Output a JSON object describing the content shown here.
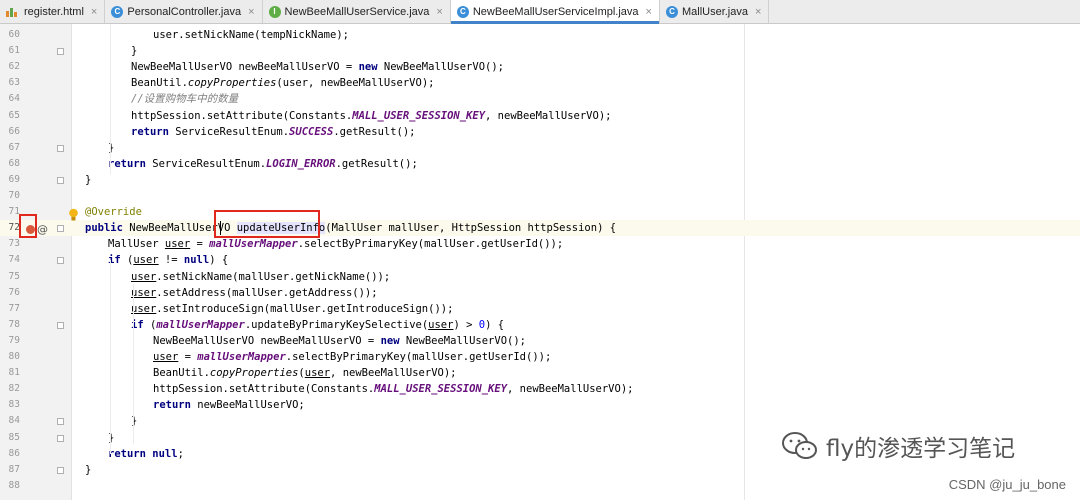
{
  "tabs": [
    {
      "label": "register.html",
      "icon": "html-file-icon",
      "active": false
    },
    {
      "label": "PersonalController.java",
      "icon": "class-file-icon",
      "active": false
    },
    {
      "label": "NewBeeMallUserService.java",
      "icon": "interface-file-icon",
      "active": false
    },
    {
      "label": "NewBeeMallUserServiceImpl.java",
      "icon": "class-file-icon",
      "active": true
    },
    {
      "label": "MallUser.java",
      "icon": "class-file-icon",
      "active": false
    }
  ],
  "close_glyph": "×",
  "code_lines": [
    {
      "n": "60",
      "segs": [
        [
          "user.setNickName(tempNickName);",
          ""
        ]
      ]
    },
    {
      "n": "61",
      "segs": [
        [
          "}",
          ""
        ]
      ]
    },
    {
      "n": "62",
      "segs": [
        [
          "NewBeeMallUserVO newBeeMallUserVO = ",
          ""
        ],
        [
          "new",
          "kw"
        ],
        [
          " NewBeeMallUserVO();",
          ""
        ]
      ]
    },
    {
      "n": "63",
      "segs": [
        [
          "BeanUtil.",
          ""
        ],
        [
          "copyProperties",
          "stat"
        ],
        [
          "(user, newBeeMallUserVO);",
          ""
        ]
      ]
    },
    {
      "n": "64",
      "segs": [
        [
          "//设置购物车中的数量",
          "cmt"
        ]
      ]
    },
    {
      "n": "65",
      "segs": [
        [
          "httpSession.setAttribute(Constants.",
          ""
        ],
        [
          "MALL_USER_SESSION_KEY",
          "fld"
        ],
        [
          ", newBeeMallUserVO);",
          ""
        ]
      ]
    },
    {
      "n": "66",
      "segs": [
        [
          "return",
          "kw"
        ],
        [
          " ServiceResultEnum.",
          ""
        ],
        [
          "SUCCESS",
          "fld"
        ],
        [
          ".getResult();",
          ""
        ]
      ]
    },
    {
      "n": "67",
      "segs": [
        [
          "}",
          ""
        ]
      ]
    },
    {
      "n": "68",
      "segs": [
        [
          "return",
          "kw"
        ],
        [
          " ServiceResultEnum.",
          ""
        ],
        [
          "LOGIN_ERROR",
          "fld"
        ],
        [
          ".getResult();",
          ""
        ]
      ]
    },
    {
      "n": "69",
      "segs": [
        [
          "}",
          ""
        ]
      ]
    },
    {
      "n": "70",
      "segs": []
    },
    {
      "n": "71",
      "segs": [
        [
          "@Override",
          "ann"
        ]
      ]
    },
    {
      "n": "72",
      "segs": [
        [
          "public",
          "kw"
        ],
        [
          " NewBeeMallUserVO ",
          ""
        ],
        [
          "updateUserInfo",
          ""
        ],
        [
          "(MallUser mallUser, HttpSession httpSession) {",
          ""
        ]
      ]
    },
    {
      "n": "73",
      "segs": [
        [
          "MallUser ",
          ""
        ],
        [
          "user",
          "ul"
        ],
        [
          " = ",
          ""
        ],
        [
          "mallUserMapper",
          "fld"
        ],
        [
          ".selectByPrimaryKey(mallUser.getUserId());",
          ""
        ]
      ]
    },
    {
      "n": "74",
      "segs": [
        [
          "if",
          "kw"
        ],
        [
          " (",
          ""
        ],
        [
          "user",
          "ul"
        ],
        [
          " != ",
          ""
        ],
        [
          "null",
          "kw"
        ],
        [
          ") {",
          ""
        ]
      ]
    },
    {
      "n": "75",
      "segs": [
        [
          "user",
          "ul"
        ],
        [
          ".setNickName(mallUser.getNickName());",
          ""
        ]
      ]
    },
    {
      "n": "76",
      "segs": [
        [
          "user",
          "ul"
        ],
        [
          ".setAddress(mallUser.getAddress());",
          ""
        ]
      ]
    },
    {
      "n": "77",
      "segs": [
        [
          "user",
          "ul"
        ],
        [
          ".setIntroduceSign(mallUser.getIntroduceSign());",
          ""
        ]
      ]
    },
    {
      "n": "78",
      "segs": [
        [
          "if",
          "kw"
        ],
        [
          " (",
          ""
        ],
        [
          "mallUserMapper",
          "fld"
        ],
        [
          ".updateByPrimaryKeySelective(",
          ""
        ],
        [
          "user",
          "ul"
        ],
        [
          ") > ",
          ""
        ],
        [
          "0",
          "num"
        ],
        [
          ") {",
          ""
        ]
      ]
    },
    {
      "n": "79",
      "segs": [
        [
          "NewBeeMallUserVO newBeeMallUserVO = ",
          ""
        ],
        [
          "new",
          "kw"
        ],
        [
          " NewBeeMallUserVO();",
          ""
        ]
      ]
    },
    {
      "n": "80",
      "segs": [
        [
          "user",
          "ul"
        ],
        [
          " = ",
          ""
        ],
        [
          "mallUserMapper",
          "fld"
        ],
        [
          ".selectByPrimaryKey(mallUser.getUserId());",
          ""
        ]
      ]
    },
    {
      "n": "81",
      "segs": [
        [
          "BeanUtil.",
          ""
        ],
        [
          "copyProperties",
          "stat"
        ],
        [
          "(",
          ""
        ],
        [
          "user",
          "ul"
        ],
        [
          ", newBeeMallUserVO);",
          ""
        ]
      ]
    },
    {
      "n": "82",
      "segs": [
        [
          "httpSession.setAttribute(Constants.",
          ""
        ],
        [
          "MALL_USER_SESSION_KEY",
          "fld"
        ],
        [
          ", newBeeMallUserVO);",
          ""
        ]
      ]
    },
    {
      "n": "83",
      "segs": [
        [
          "return",
          "kw"
        ],
        [
          " newBeeMallUserVO;",
          ""
        ]
      ]
    },
    {
      "n": "84",
      "segs": [
        [
          "}",
          ""
        ]
      ]
    },
    {
      "n": "85",
      "segs": [
        [
          "}",
          ""
        ]
      ]
    },
    {
      "n": "86",
      "segs": [
        [
          "return",
          "kw"
        ],
        [
          " ",
          ""
        ],
        [
          "null",
          "kw"
        ],
        [
          ";",
          ""
        ]
      ]
    },
    {
      "n": "87",
      "segs": [
        [
          "}",
          ""
        ]
      ]
    },
    {
      "n": "88",
      "segs": []
    }
  ],
  "watermark": "fly的渗透学习笔记",
  "credit": "CSDN @ju_ju_bone",
  "colors": {
    "highlight_box": "#e0281f",
    "active_tab_underline": "#4083c9"
  }
}
